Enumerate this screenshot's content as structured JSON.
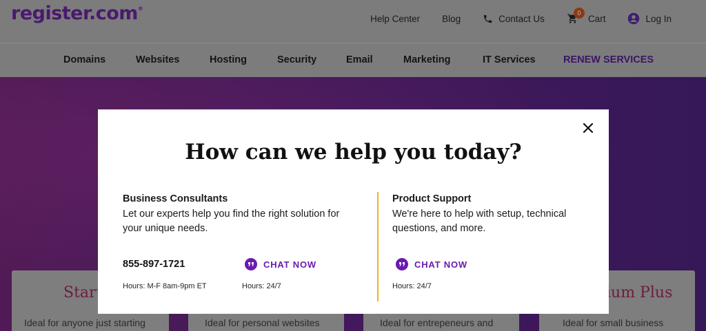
{
  "header": {
    "logo_text": "register.com",
    "logo_mark": "®",
    "links": {
      "help_center": "Help Center",
      "blog": "Blog",
      "contact_us": "Contact Us",
      "cart": "Cart",
      "cart_count": "0",
      "login": "Log In"
    }
  },
  "nav": {
    "items": [
      "Domains",
      "Websites",
      "Hosting",
      "Security",
      "Email",
      "Marketing",
      "IT Services",
      "RENEW SERVICES"
    ]
  },
  "hero_cards": [
    {
      "title": "Start",
      "text": "Ideal for anyone just starting"
    },
    {
      "title": "",
      "text": "Ideal for personal websites"
    },
    {
      "title": "",
      "text": "Ideal for entrepeneurs and"
    },
    {
      "title": "ium Plus",
      "text": "Ideal for small business"
    }
  ],
  "modal": {
    "title": "How can we help you today?",
    "left": {
      "heading": "Business Consultants",
      "description": "Let our experts help you find the right solution for your unique needs.",
      "phone": "855-897-1721",
      "phone_hours": "Hours: M-F 8am-9pm ET",
      "chat_label": "CHAT NOW",
      "chat_hours": "Hours: 24/7"
    },
    "right": {
      "heading": "Product Support",
      "description": "We're here to help with setup, technical questions, and more.",
      "chat_label": "CHAT NOW",
      "chat_hours": "Hours: 24/7"
    }
  },
  "colors": {
    "accent_purple": "#6a1ab0",
    "divider_yellow": "#f2b21a",
    "brand_dark": "#4a1a6e"
  }
}
